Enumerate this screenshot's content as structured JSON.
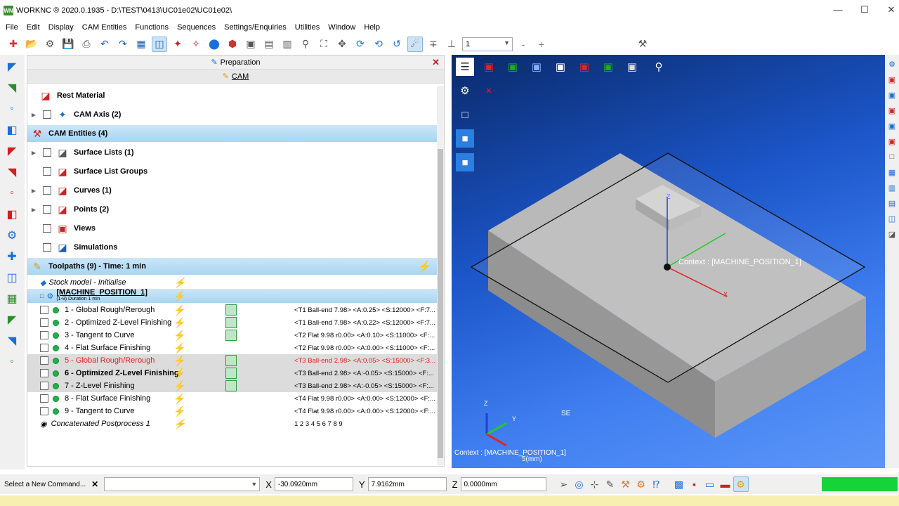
{
  "window": {
    "title": "WORKNC ® 2020.0.1935 - D:\\TEST\\0413\\UC01e02\\UC01e02\\",
    "logo": "WN"
  },
  "menu": [
    "File",
    "Edit",
    "Display",
    "CAM Entities",
    "Functions",
    "Sequences",
    "Settings/Enquiries",
    "Utilities",
    "Window",
    "Help"
  ],
  "toolbar": {
    "combo_value": "1",
    "minus": "-",
    "plus": "+"
  },
  "panel": {
    "header1": "Preparation",
    "header2": "CAM",
    "tree": {
      "rest_material": "Rest Material",
      "cam_axis": "CAM Axis (2)",
      "cam_entities": "CAM Entities (4)",
      "surface_lists": "Surface Lists (1)",
      "surface_list_groups": "Surface List Groups",
      "curves": "Curves (1)",
      "points": "Points (2)",
      "views": "Views",
      "simulations": "Simulations",
      "toolpaths": "Toolpaths (9) - Time: 1 min",
      "stock_model": "Stock model - Initialise",
      "machine_position": "[MACHINE_POSITION_1]",
      "machine_duration": "(1-9) Duration 1 min",
      "concatenated": "Concatenated Postprocess 1",
      "concatenated_seq": "1 2 3 4 5 6 7 8 9"
    },
    "toolpaths": [
      {
        "label": "1 - Global Rough/Rerough",
        "params": "<T1 Ball-end 7.98> <A:0.25> <S:12000> <F:7..."
      },
      {
        "label": "2 - Optimized Z-Level Finishing",
        "params": "<T1 Ball-end 7.98> <A:0.22> <S:12000> <F:7..."
      },
      {
        "label": "3 - Tangent to Curve",
        "params": "<T2 Flat 9.98 r0.00> <A:0.10> <S:11000> <F:..."
      },
      {
        "label": "4 - Flat Surface Finishing",
        "params": "<T2 Flat 9.98 r0.00> <A:0.00> <S:11000> <F:..."
      },
      {
        "label": "5 - Global Rough/Rerough",
        "params": "<T3 Ball-end 2.98> <A:0.05> <S:15000> <F:3..."
      },
      {
        "label": "6 - Optimized Z-Level Finishing",
        "params": "<T3 Ball-end 2.98> <A:-0.05> <S:15000> <F:..."
      },
      {
        "label": "7 - Z-Level Finishing",
        "params": "<T3 Ball-end 2.98> <A:-0.05> <S:15000> <F:..."
      },
      {
        "label": "8 - Flat Surface Finishing",
        "params": "<T4 Flat 9.98 r0.00> <A:0.00> <S:12000> <F:..."
      },
      {
        "label": "9 - Tangent to Curve",
        "params": "<T4 Flat 9.98 r0.00> <A:0.00> <S:12000> <F:..."
      }
    ]
  },
  "viewport": {
    "context_label": "Context : [MACHINE_POSITION_1]",
    "context_bottom": "Context : [MACHINE_POSITION_1]",
    "scale": "5(mm)",
    "cursor_hint": "SE",
    "axis_x": "X",
    "axis_y": "Y",
    "axis_z": "Z"
  },
  "status": {
    "command_label": "Select a New Command...",
    "x_label": "X",
    "x_value": "-30.0920mm",
    "y_label": "Y",
    "y_value": "7.9162mm",
    "z_label": "Z",
    "z_value": "0.0000mm",
    "progress": 1.0
  },
  "colors": {
    "accent": "#cde3f7",
    "selected": "#a9d5f2",
    "error": "#e2231a",
    "ok": "#1fb24a",
    "progress": "#16d33a"
  }
}
